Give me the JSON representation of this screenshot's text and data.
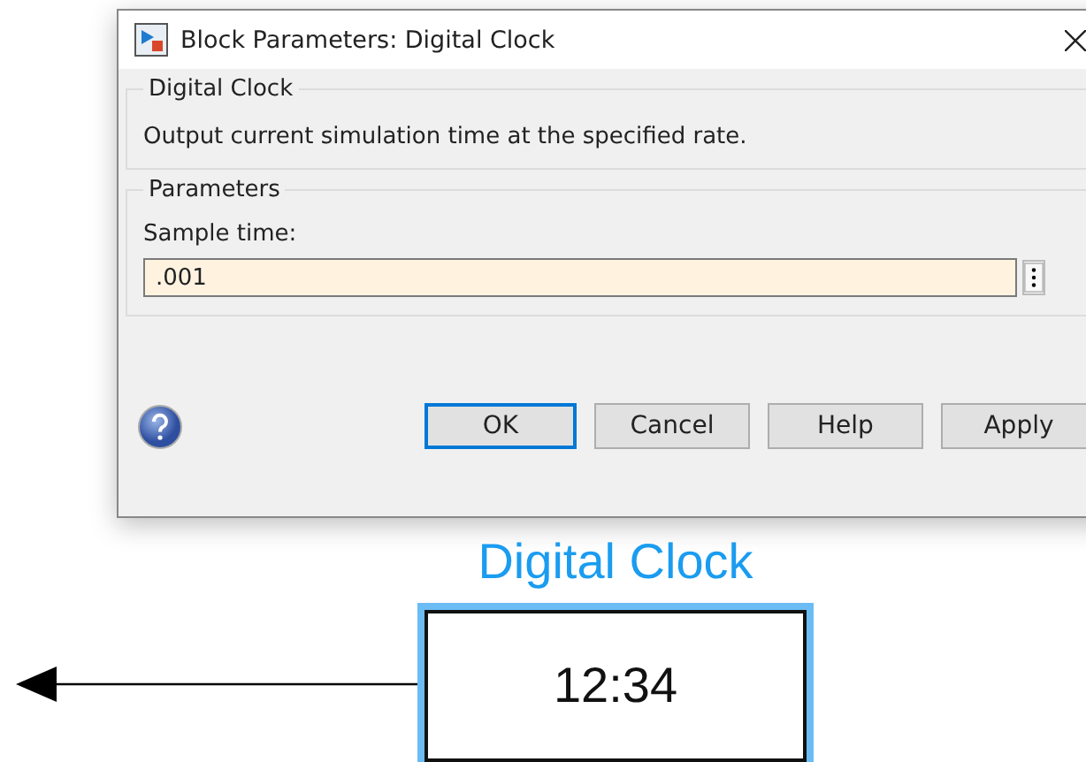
{
  "dialog": {
    "title": "Block Parameters: Digital Clock",
    "groups": [
      {
        "title": "Digital Clock",
        "description": "Output current simulation time at the specified rate."
      },
      {
        "title": "Parameters",
        "fields": [
          {
            "label": "Sample time:",
            "value": ".001"
          }
        ]
      }
    ],
    "buttons": [
      {
        "label": "OK",
        "default": true
      },
      {
        "label": "Cancel",
        "default": false
      },
      {
        "label": "Help",
        "default": false
      },
      {
        "label": "Apply",
        "default": false
      }
    ]
  },
  "block": {
    "name": "Digital Clock",
    "display": "12:34",
    "selected": true
  }
}
